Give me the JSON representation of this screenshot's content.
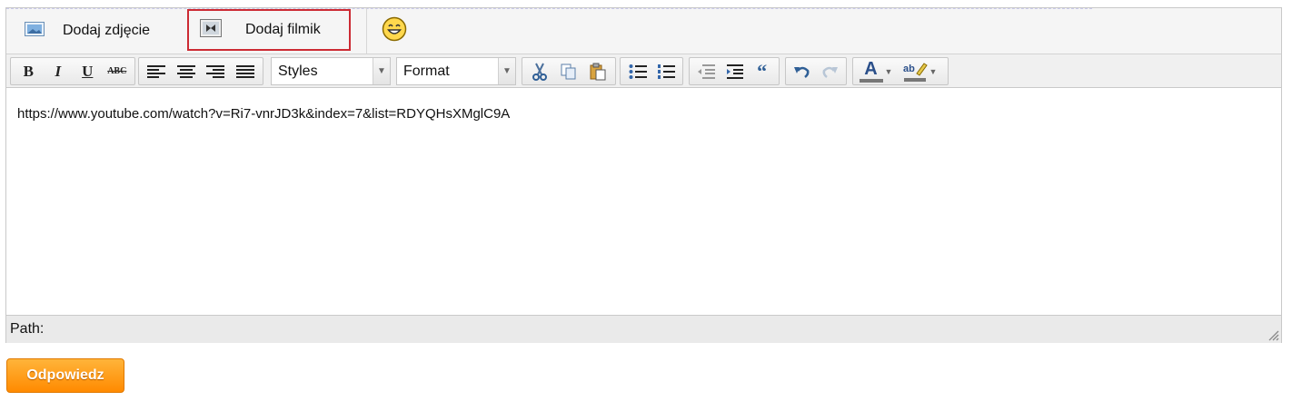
{
  "tabs": {
    "photo_label": "Dodaj zdjęcie",
    "video_label": "Dodaj filmik"
  },
  "toolbar": {
    "bold": "B",
    "italic": "I",
    "underline": "U",
    "strike": "ABC",
    "styles_value": "Styles",
    "format_value": "Format",
    "text_color_glyph": "A"
  },
  "editor": {
    "content": "https://www.youtube.com/watch?v=Ri7-vnrJD3k&index=7&list=RDYQHsXMglC9A",
    "path_label": "Path:"
  },
  "reply_button": "Odpowiedz",
  "colors": {
    "highlight_border": "#cc2a33",
    "reply_button": "#ff9a1a"
  }
}
